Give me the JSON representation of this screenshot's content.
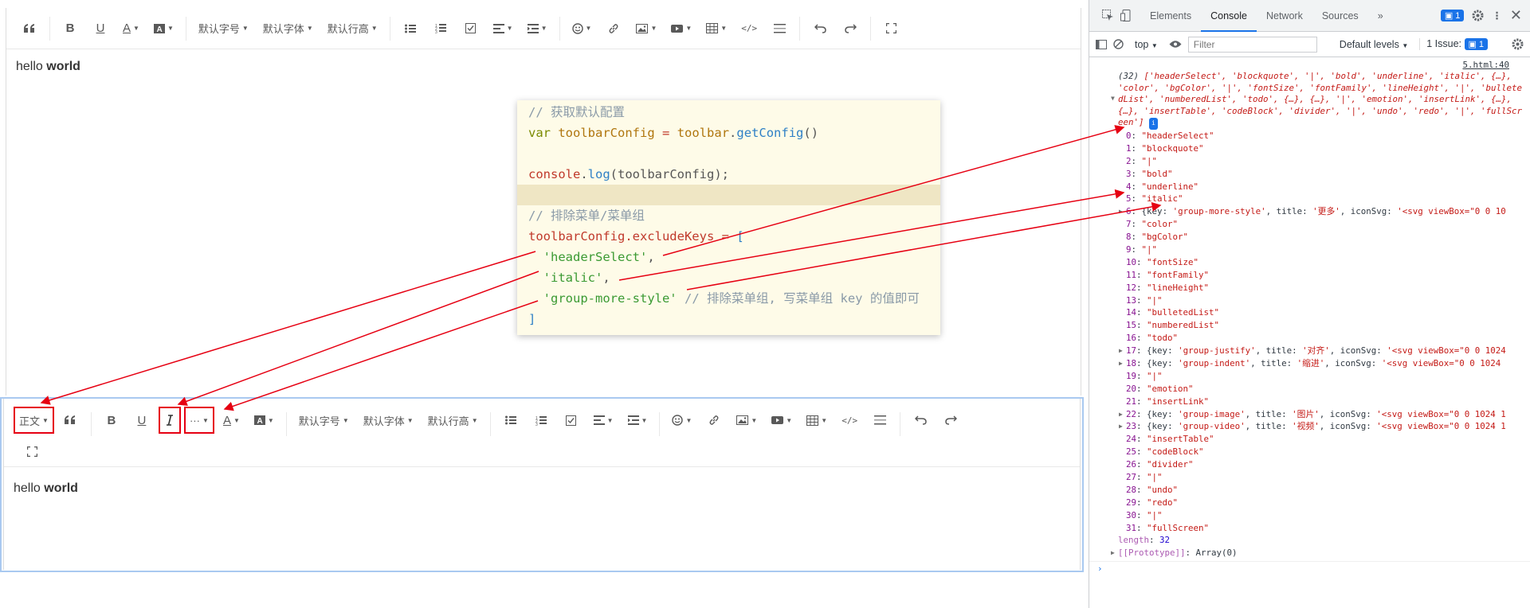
{
  "editor_top": {
    "toolbar": {
      "blockquote_icon": "blockquote-icon",
      "font_size": "默认字号",
      "font_family": "默认字体",
      "line_height": "默认行高"
    },
    "content": {
      "text_plain": "hello",
      "text_bold": "world"
    }
  },
  "code": {
    "line1": "// 获取默认配置",
    "line2_kw": "var",
    "line2_var": "toolbarConfig",
    "line2_eq": "=",
    "line2_obj": "toolbar",
    "line2_dot": ".",
    "line2_fn": "getConfig",
    "line2_paren": "()",
    "line4_obj": "console",
    "line4_dot": ".",
    "line4_fn": "log",
    "line4_arg": "(toolbarConfig);",
    "line6": "// 排除菜单/菜单组",
    "line7_obj": "toolbarConfig.excludeKeys",
    "line7_eq": "=",
    "line7_br": "[",
    "line8": "'headerSelect'",
    "line9": "'italic'",
    "line10": "'group-more-style'",
    "line10_comment": "// 排除菜单组, 写菜单组 key 的值即可",
    "line11": "]",
    "comma": ","
  },
  "editor_bottom": {
    "toolbar": {
      "header_select": "正文",
      "more": "···",
      "font_size": "默认字号",
      "font_family": "默认字体",
      "line_height": "默认行高"
    },
    "content": {
      "text_plain": "hello",
      "text_bold": "world"
    }
  },
  "devtools": {
    "tabs": [
      "Elements",
      "Console",
      "Network",
      "Sources"
    ],
    "more_tabs": "»",
    "issues_badge": "1",
    "context": "top",
    "filter_placeholder": "Filter",
    "levels": "Default levels",
    "issue_count": "1 Issue:",
    "issue_badge2": "1",
    "source_link": "5.html:40",
    "summary_prefix": "(32) ",
    "summary": "['headerSelect', 'blockquote', '|', 'bold', 'underline', 'italic', {…}, 'color', 'bgColor', '|', 'fontSize', 'fontFamily', 'lineHeight', '|', 'bulletedList', 'numberedList', 'todo', {…}, {…}, '|', 'emotion', 'insertLink', {…}, {…}, 'insertTable', 'codeBlock', 'divider', '|', 'undo', 'redo', '|', 'fullScreen']",
    "items": [
      {
        "k": "0",
        "v": "\"headerSelect\""
      },
      {
        "k": "1",
        "v": "\"blockquote\""
      },
      {
        "k": "2",
        "v": "\"|\""
      },
      {
        "k": "3",
        "v": "\"bold\""
      },
      {
        "k": "4",
        "v": "\"underline\""
      },
      {
        "k": "5",
        "v": "\"italic\""
      },
      {
        "k": "6",
        "obj": true,
        "key": "group-more-style",
        "title": "更多",
        "svg": "'<svg viewBox=\"0 0 10"
      },
      {
        "k": "7",
        "v": "\"color\""
      },
      {
        "k": "8",
        "v": "\"bgColor\""
      },
      {
        "k": "9",
        "v": "\"|\""
      },
      {
        "k": "10",
        "v": "\"fontSize\""
      },
      {
        "k": "11",
        "v": "\"fontFamily\""
      },
      {
        "k": "12",
        "v": "\"lineHeight\""
      },
      {
        "k": "13",
        "v": "\"|\""
      },
      {
        "k": "14",
        "v": "\"bulletedList\""
      },
      {
        "k": "15",
        "v": "\"numberedList\""
      },
      {
        "k": "16",
        "v": "\"todo\""
      },
      {
        "k": "17",
        "obj": true,
        "key": "group-justify",
        "title": "对齐",
        "svg": "'<svg viewBox=\"0 0 1024"
      },
      {
        "k": "18",
        "obj": true,
        "key": "group-indent",
        "title": "缩进",
        "svg": "'<svg viewBox=\"0 0 1024"
      },
      {
        "k": "19",
        "v": "\"|\""
      },
      {
        "k": "20",
        "v": "\"emotion\""
      },
      {
        "k": "21",
        "v": "\"insertLink\""
      },
      {
        "k": "22",
        "obj": true,
        "key": "group-image",
        "title": "图片",
        "svg": "'<svg viewBox=\"0 0 1024 1"
      },
      {
        "k": "23",
        "obj": true,
        "key": "group-video",
        "title": "视频",
        "svg": "'<svg viewBox=\"0 0 1024 1"
      },
      {
        "k": "24",
        "v": "\"insertTable\""
      },
      {
        "k": "25",
        "v": "\"codeBlock\""
      },
      {
        "k": "26",
        "v": "\"divider\""
      },
      {
        "k": "27",
        "v": "\"|\""
      },
      {
        "k": "28",
        "v": "\"undo\""
      },
      {
        "k": "29",
        "v": "\"redo\""
      },
      {
        "k": "30",
        "v": "\"|\""
      },
      {
        "k": "31",
        "v": "\"fullScreen\""
      }
    ],
    "length_label": "length",
    "length_value": "32",
    "prototype_label": "[[Prototype]]",
    "prototype_value": "Array(0)",
    "prompt": "›"
  },
  "colors": {
    "arrow": "#e60012",
    "accent": "#1a73e8",
    "code_bg": "#fefbe8",
    "editor_focus_border": "#a9c9f0"
  }
}
